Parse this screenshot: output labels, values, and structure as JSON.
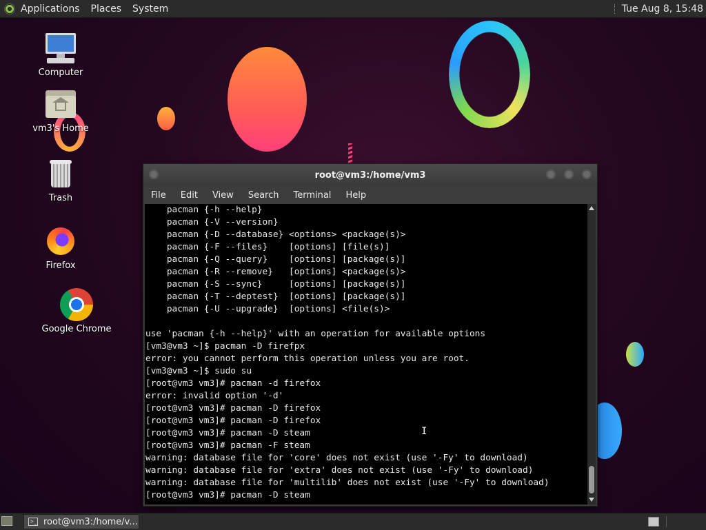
{
  "top_panel": {
    "menus": [
      "Applications",
      "Places",
      "System"
    ],
    "clock": "Tue Aug  8, 15:48"
  },
  "desktop_icons": [
    {
      "label": "Computer",
      "icon": "computer-icon"
    },
    {
      "label": "vm3's Home",
      "icon": "home-folder-icon"
    },
    {
      "label": "Trash",
      "icon": "trash-icon"
    },
    {
      "label": "Firefox",
      "icon": "firefox-icon"
    },
    {
      "label": "Google Chrome",
      "icon": "chrome-icon"
    }
  ],
  "terminal_window": {
    "title": "root@vm3:/home/vm3",
    "menus": [
      "File",
      "Edit",
      "View",
      "Search",
      "Terminal",
      "Help"
    ],
    "lines": [
      "    pacman {-h --help}",
      "    pacman {-V --version}",
      "    pacman {-D --database} <options> <package(s)>",
      "    pacman {-F --files}    [options] [file(s)]",
      "    pacman {-Q --query}    [options] [package(s)]",
      "    pacman {-R --remove}   [options] <package(s)>",
      "    pacman {-S --sync}     [options] [package(s)]",
      "    pacman {-T --deptest}  [options] [package(s)]",
      "    pacman {-U --upgrade}  [options] <file(s)>",
      "",
      "use 'pacman {-h --help}' with an operation for available options",
      "[vm3@vm3 ~]$ pacman -D firefpx",
      "error: you cannot perform this operation unless you are root.",
      "[vm3@vm3 ~]$ sudo su",
      "[root@vm3 vm3]# pacman -d firefox",
      "error: invalid option '-d'",
      "[root@vm3 vm3]# pacman -D firefox",
      "[root@vm3 vm3]# pacman -D firefox",
      "[root@vm3 vm3]# pacman -D steam",
      "[root@vm3 vm3]# pacman -F steam",
      "warning: database file for 'core' does not exist (use '-Fy' to download)",
      "warning: database file for 'extra' does not exist (use '-Fy' to download)",
      "warning: database file for 'multilib' does not exist (use '-Fy' to download)",
      "[root@vm3 vm3]# pacman -D steam"
    ]
  },
  "bottom_panel": {
    "task_label": "root@vm3:/home/v..."
  },
  "colors": {
    "panel": "#2b2b2b",
    "terminal_bg": "#000000",
    "terminal_fg": "#e8e8e8"
  }
}
